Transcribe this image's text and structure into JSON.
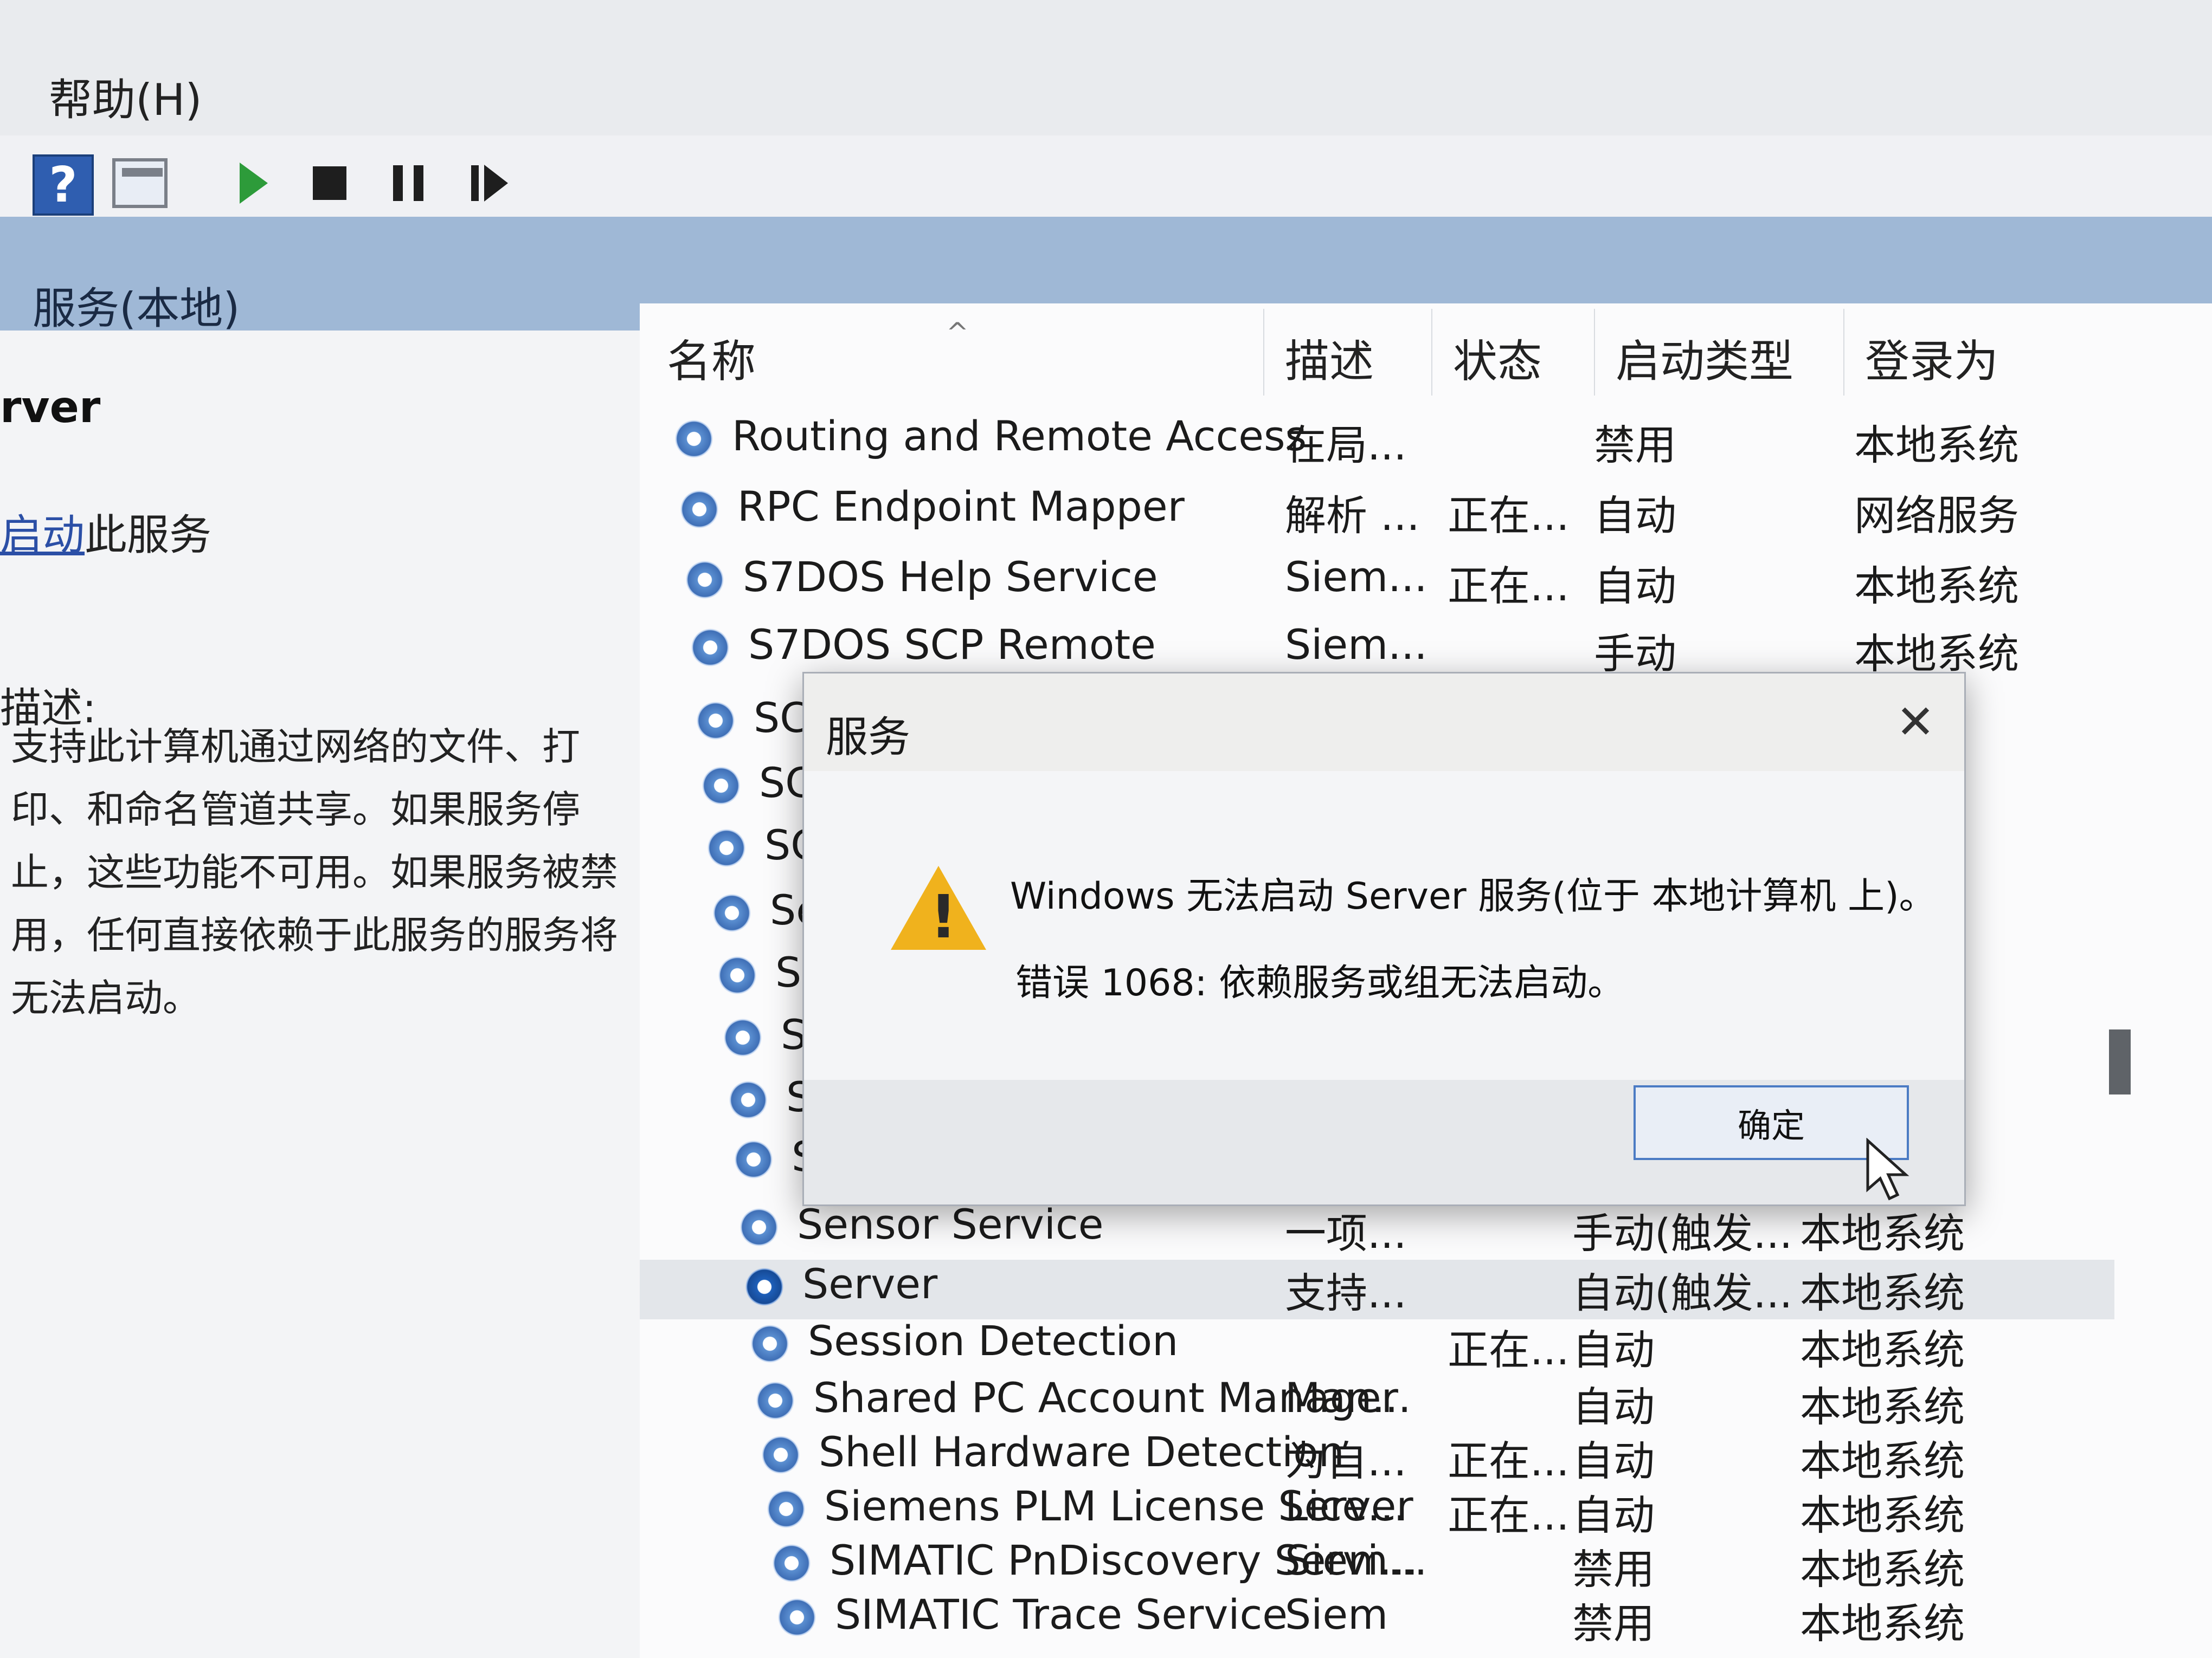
{
  "menubar": {
    "help": "帮助(H)"
  },
  "toolbar": {
    "help_glyph": "?"
  },
  "header": {
    "title": "服务(本地)"
  },
  "left_panel": {
    "service_name": "rver",
    "action_prefix": "启动",
    "action_suffix": "此服务",
    "desc_label": "描述:",
    "description": "支持此计算机通过网络的文件、打印、和命名管道共享。如果服务停止，这些功能不可用。如果服务被禁用，任何直接依赖于此服务的服务将无法启动。"
  },
  "table": {
    "columns": [
      "名称",
      "描述",
      "状态",
      "启动类型",
      "登录为"
    ],
    "rows": [
      {
        "name": "Routing and Remote Access",
        "desc": "在局...",
        "status": "",
        "startup": "禁用",
        "logon": "本地系统"
      },
      {
        "name": "RPC Endpoint Mapper",
        "desc": "解析 ...",
        "status": "正在...",
        "startup": "自动",
        "logon": "网络服务"
      },
      {
        "name": "S7DOS Help Service",
        "desc": "Siem...",
        "status": "正在...",
        "startup": "自动",
        "logon": "本地系统"
      },
      {
        "name": "S7DOS SCP Remote",
        "desc": "Siem...",
        "status": "",
        "startup": "手动",
        "logon": "本地系统"
      },
      {
        "name": "SC",
        "desc": "",
        "status": "",
        "startup": "",
        "logon": ""
      },
      {
        "name": "SC",
        "desc": "",
        "status": "",
        "startup": "",
        "logon": ""
      },
      {
        "name": "SC",
        "desc": "",
        "status": "",
        "startup": "",
        "logon": ""
      },
      {
        "name": "Se",
        "desc": "",
        "status": "",
        "startup": "",
        "logon": ""
      },
      {
        "name": "Se",
        "desc": "",
        "status": "",
        "startup": "",
        "logon": ""
      },
      {
        "name": "Se",
        "desc": "",
        "status": "",
        "startup": "",
        "logon": ""
      },
      {
        "name": "Se",
        "desc": "",
        "status": "",
        "startup": "",
        "logon": ""
      },
      {
        "name": "Se",
        "desc": "",
        "status": "",
        "startup": "",
        "logon": ""
      },
      {
        "name": "Sensor Service",
        "desc": "一项...",
        "status": "",
        "startup": "手动(触发...",
        "logon": "本地系统"
      },
      {
        "name": "Server",
        "desc": "支持...",
        "status": "",
        "startup": "自动(触发...",
        "logon": "本地系统"
      },
      {
        "name": "Session Detection",
        "desc": "",
        "status": "正在...",
        "startup": "自动",
        "logon": "本地系统"
      },
      {
        "name": "Shared PC Account Manager",
        "desc": "Man...",
        "status": "",
        "startup": "自动",
        "logon": "本地系统"
      },
      {
        "name": "Shell Hardware Detection",
        "desc": "为自...",
        "status": "正在...",
        "startup": "自动",
        "logon": "本地系统"
      },
      {
        "name": "Siemens PLM License Server",
        "desc": "Lice...",
        "status": "正在...",
        "startup": "自动",
        "logon": "本地系统"
      },
      {
        "name": "SIMATIC PnDiscovery Servi...",
        "desc": "Siem...",
        "status": "",
        "startup": "禁用",
        "logon": "本地系统"
      },
      {
        "name": "SIMATIC Trace Service",
        "desc": "Siem",
        "status": "",
        "startup": "禁用",
        "logon": "本地系统"
      }
    ]
  },
  "dialog": {
    "title": "服务",
    "close_glyph": "✕",
    "message": "Windows 无法启动 Server 服务(位于 本地计算机 上)。",
    "error": "错误 1068: 依赖服务或组无法启动。",
    "ok_label": "确定",
    "warning_glyph": "!"
  }
}
